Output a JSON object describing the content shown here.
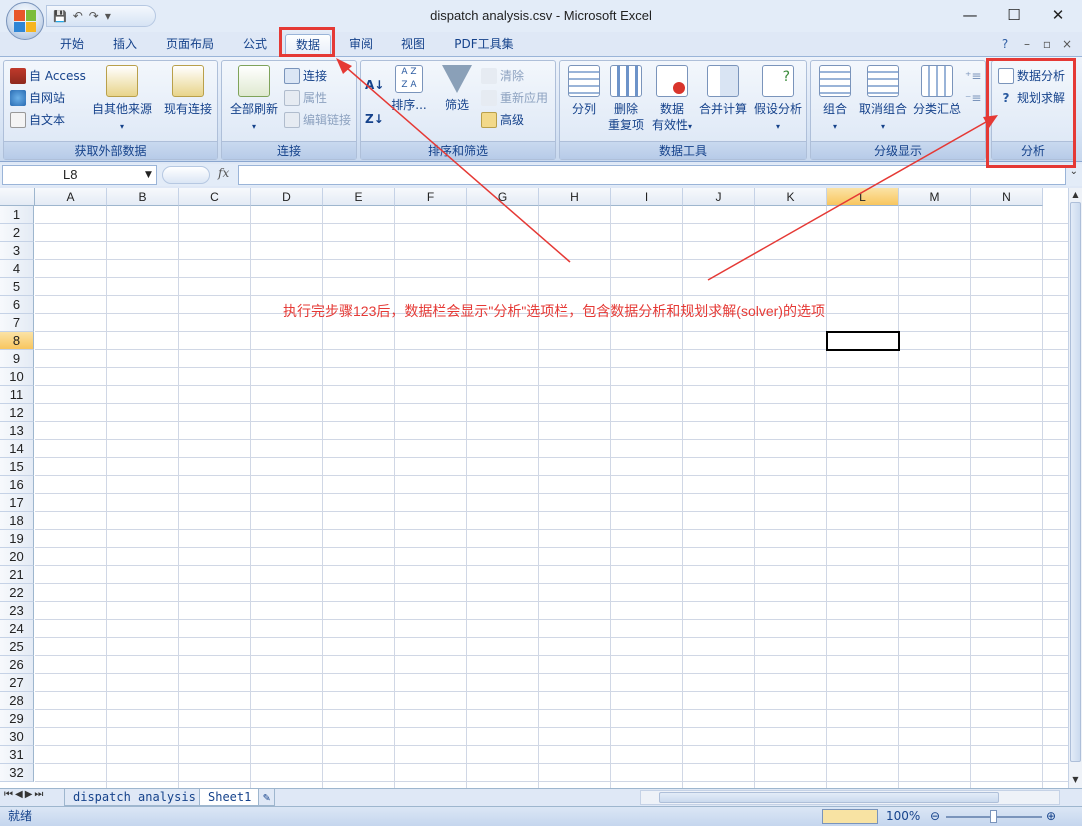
{
  "window": {
    "title": "dispatch analysis.csv - Microsoft Excel",
    "minimize": "—",
    "maximize": "☐",
    "close": "✕"
  },
  "qat": {
    "save": "💾",
    "undo": "↶",
    "redo": "↷",
    "customize": "▾"
  },
  "tabs": [
    "开始",
    "插入",
    "页面布局",
    "公式",
    "数据",
    "审阅",
    "视图",
    "PDF工具集"
  ],
  "active_tab": "数据",
  "ribbon": {
    "get_external": {
      "label": "获取外部数据",
      "access": "自 Access",
      "web": "自网站",
      "text": "自文本",
      "other": "自其他来源",
      "existing": "现有连接"
    },
    "connections": {
      "label": "连接",
      "refresh_all": "全部刷新",
      "connections": "连接",
      "properties": "属性",
      "edit_links": "编辑链接"
    },
    "sort_filter": {
      "label": "排序和筛选",
      "sort": "排序...",
      "filter": "筛选",
      "clear": "清除",
      "reapply": "重新应用",
      "advanced": "高级"
    },
    "data_tools": {
      "label": "数据工具",
      "text_to_columns": "分列",
      "remove_dup_1": "删除",
      "remove_dup_2": "重复项",
      "validation_1": "数据",
      "validation_2": "有效性",
      "consolidate": "合并计算",
      "what_if": "假设分析"
    },
    "outline": {
      "label": "分级显示",
      "group": "组合",
      "ungroup": "取消组合",
      "subtotal": "分类汇总"
    },
    "analysis": {
      "label": "分析",
      "data_analysis": "数据分析",
      "solver": "规划求解"
    }
  },
  "formula_bar": {
    "name_box": "L8",
    "fx": "fx",
    "value": ""
  },
  "columns": [
    "A",
    "B",
    "C",
    "D",
    "E",
    "F",
    "G",
    "H",
    "I",
    "J",
    "K",
    "L",
    "M",
    "N"
  ],
  "rows": [
    "1",
    "2",
    "3",
    "4",
    "5",
    "6",
    "7",
    "8",
    "9",
    "10",
    "11",
    "12",
    "13",
    "14",
    "15",
    "16",
    "17",
    "18",
    "19",
    "20",
    "21",
    "22",
    "23",
    "24",
    "25",
    "26",
    "27",
    "28",
    "29",
    "30",
    "31",
    "32"
  ],
  "selected_cell": {
    "col": "L",
    "row": "8"
  },
  "sheets": [
    "dispatch analysis",
    "Sheet1"
  ],
  "active_sheet": "Sheet1",
  "status": {
    "ready": "就绪",
    "zoom": "100%"
  },
  "annotation": "执行完步骤123后，数据栏会显示\"分析\"选项栏，包含数据分析和规划求解(solver)的选项",
  "colors": {
    "annotation": "#e53935",
    "ribbon": "#dbe6f5",
    "header_highlight": "#f8c65f"
  }
}
